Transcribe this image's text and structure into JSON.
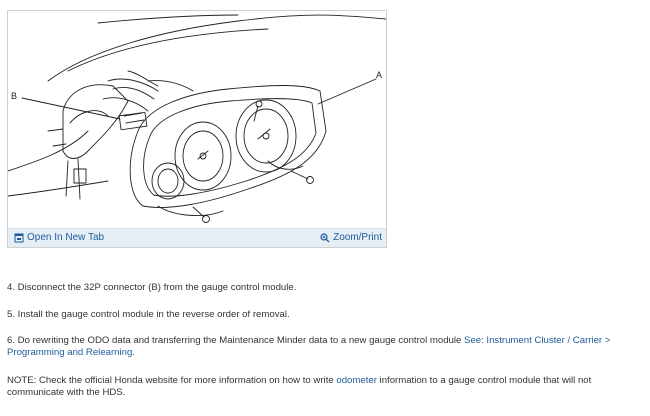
{
  "figure": {
    "callout_a": "A",
    "callout_b": "B",
    "open_new_tab_label": "Open In New Tab",
    "zoom_print_label": "Zoom/Print",
    "icons": {
      "open_tab": "open-new-tab-icon",
      "zoom": "magnifier-zoom-icon"
    }
  },
  "steps": {
    "step4": " 4. Disconnect the 32P connector (B) from the gauge control module.",
    "step5": " 5. Install the gauge control module in the reverse order of removal.",
    "step6_text": " 6. Do rewriting the ODO data and transferring the Maintenance Minder data to a new gauge control module ",
    "step6_link": "See: Instrument Cluster / Carrier > Programming and Relearning",
    "step6_end": ".",
    "note_before": "NOTE: Check the official Honda website for more information on how to write ",
    "note_link": "odometer",
    "note_after": " information to a gauge control module that will not communicate with the HDS."
  },
  "colors": {
    "link": "#1f5b9a",
    "toolbar_bg": "#e6eef6",
    "text": "#333333"
  }
}
